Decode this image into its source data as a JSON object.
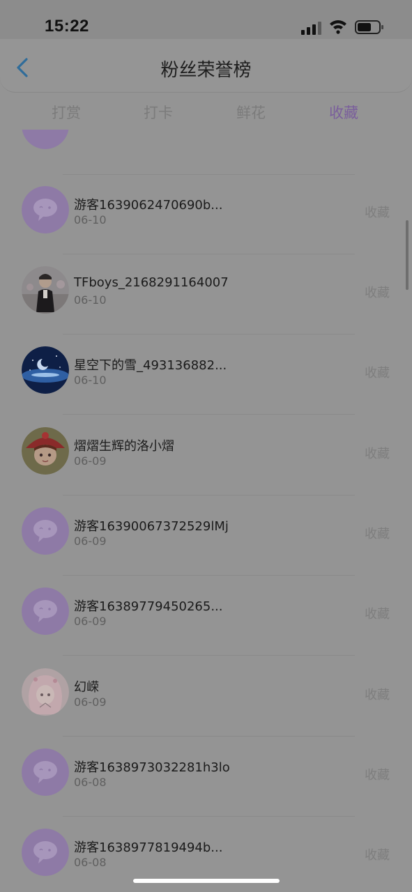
{
  "status_bar": {
    "time": "15:22",
    "icons": [
      "signal-icon",
      "wifi-icon",
      "battery-icon"
    ]
  },
  "header": {
    "title": "粉丝荣誉榜",
    "back_icon": "chevron-left-icon"
  },
  "tabs": [
    {
      "label": "打赏",
      "active": false
    },
    {
      "label": "打卡",
      "active": false
    },
    {
      "label": "鲜花",
      "active": false
    },
    {
      "label": "收藏",
      "active": true
    }
  ],
  "list": {
    "items": [
      {
        "name": "游客1639062470690b...",
        "date": "06-10",
        "action": "收藏",
        "avatar": "default-chat-avatar"
      },
      {
        "name": "TFboys_2168291164007",
        "date": "06-10",
        "action": "收藏",
        "avatar": "photo-avatar"
      },
      {
        "name": "星空下的雪_493136882...",
        "date": "06-10",
        "action": "收藏",
        "avatar": "night-sky-avatar"
      },
      {
        "name": "熠熠生辉的洛小熠",
        "date": "06-09",
        "action": "收藏",
        "avatar": "red-hat-cartoon-avatar"
      },
      {
        "name": "游客16390067372529lMj",
        "date": "06-09",
        "action": "收藏",
        "avatar": "default-chat-avatar"
      },
      {
        "name": "游客16389779450265...",
        "date": "06-09",
        "action": "收藏",
        "avatar": "default-chat-avatar"
      },
      {
        "name": "幻嵘",
        "date": "06-09",
        "action": "收藏",
        "avatar": "anime-girl-avatar"
      },
      {
        "name": "游客1638973032281h3lo",
        "date": "06-08",
        "action": "收藏",
        "avatar": "default-chat-avatar"
      },
      {
        "name": "游客1638977819494b...",
        "date": "06-08",
        "action": "收藏",
        "avatar": "default-chat-avatar"
      }
    ]
  },
  "colors": {
    "accent_purple": "#7a5e9c",
    "avatar_purple": "#8e7aa6",
    "overlay_gray": "#949494"
  }
}
